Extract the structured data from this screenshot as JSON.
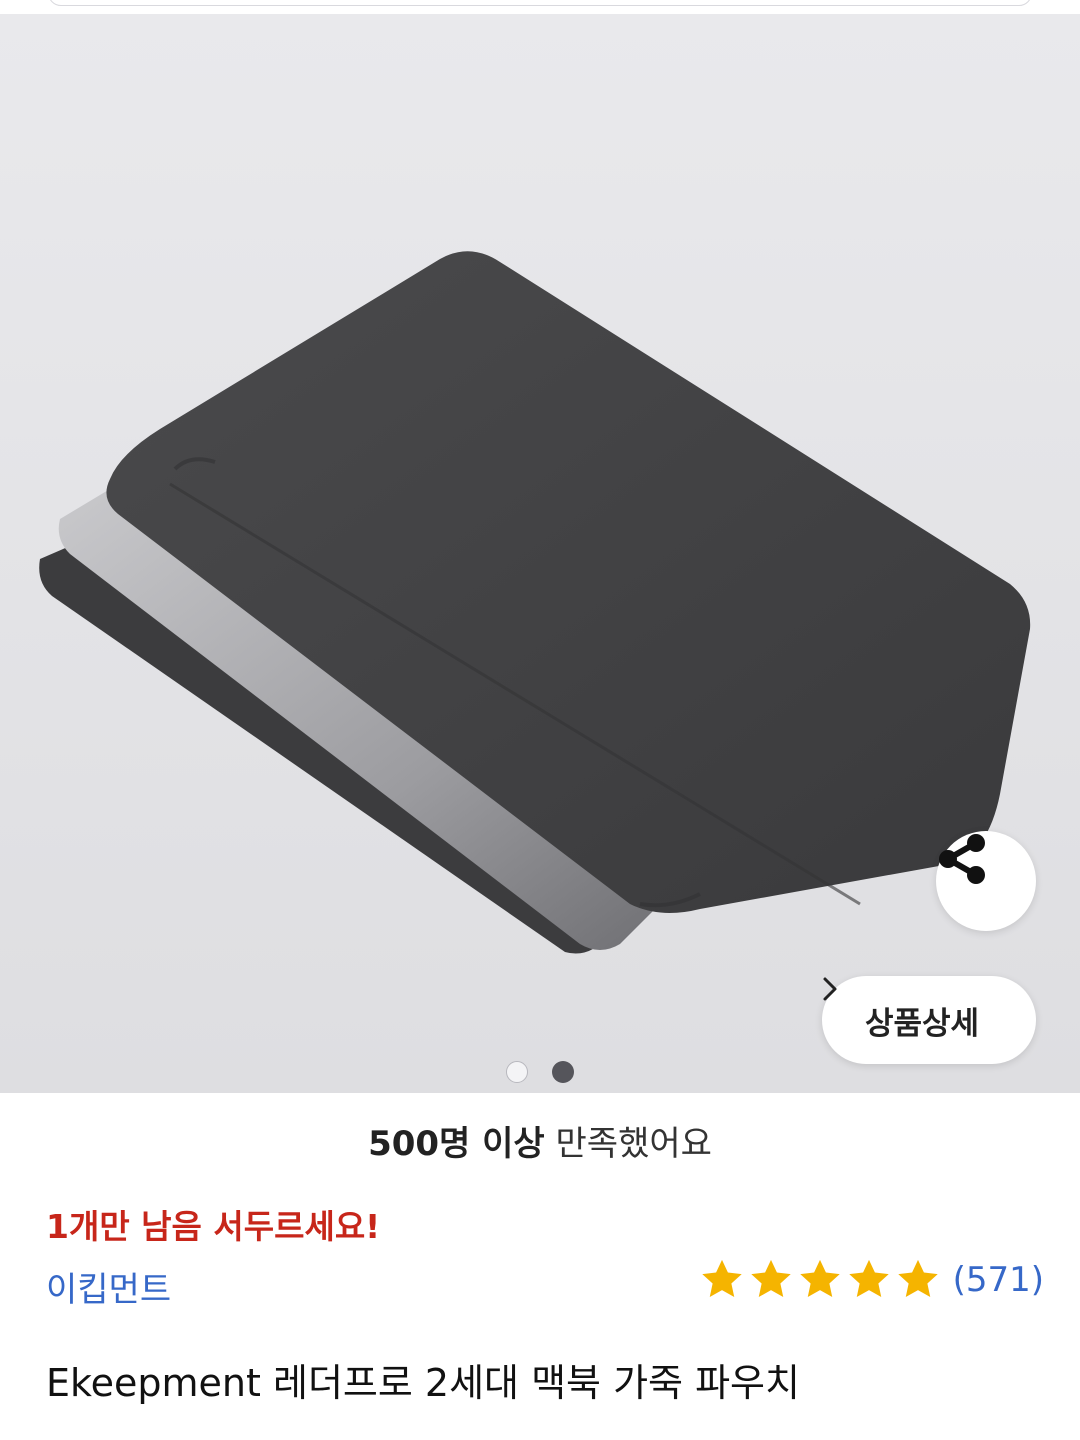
{
  "gallery": {
    "share_icon": "share-icon",
    "detail_button_label": "상품상세",
    "detail_chevron_icon": "chevron-right-icon",
    "page_count": 2,
    "active_page": 2
  },
  "satisfaction": {
    "strong": "500명 이상",
    "rest": "만족했어요"
  },
  "stock_warning": "1개만 남음 서두르세요!",
  "brand": "이킵먼트",
  "rating": {
    "stars": 5,
    "max_stars": 5,
    "star_color": "#f5b400",
    "review_count": "(571)"
  },
  "product_title": "Ekeepment 레더프로 2세대 맥북 가죽 파우치",
  "colors": {
    "warning": "#c7261a",
    "link": "#3668c8"
  }
}
